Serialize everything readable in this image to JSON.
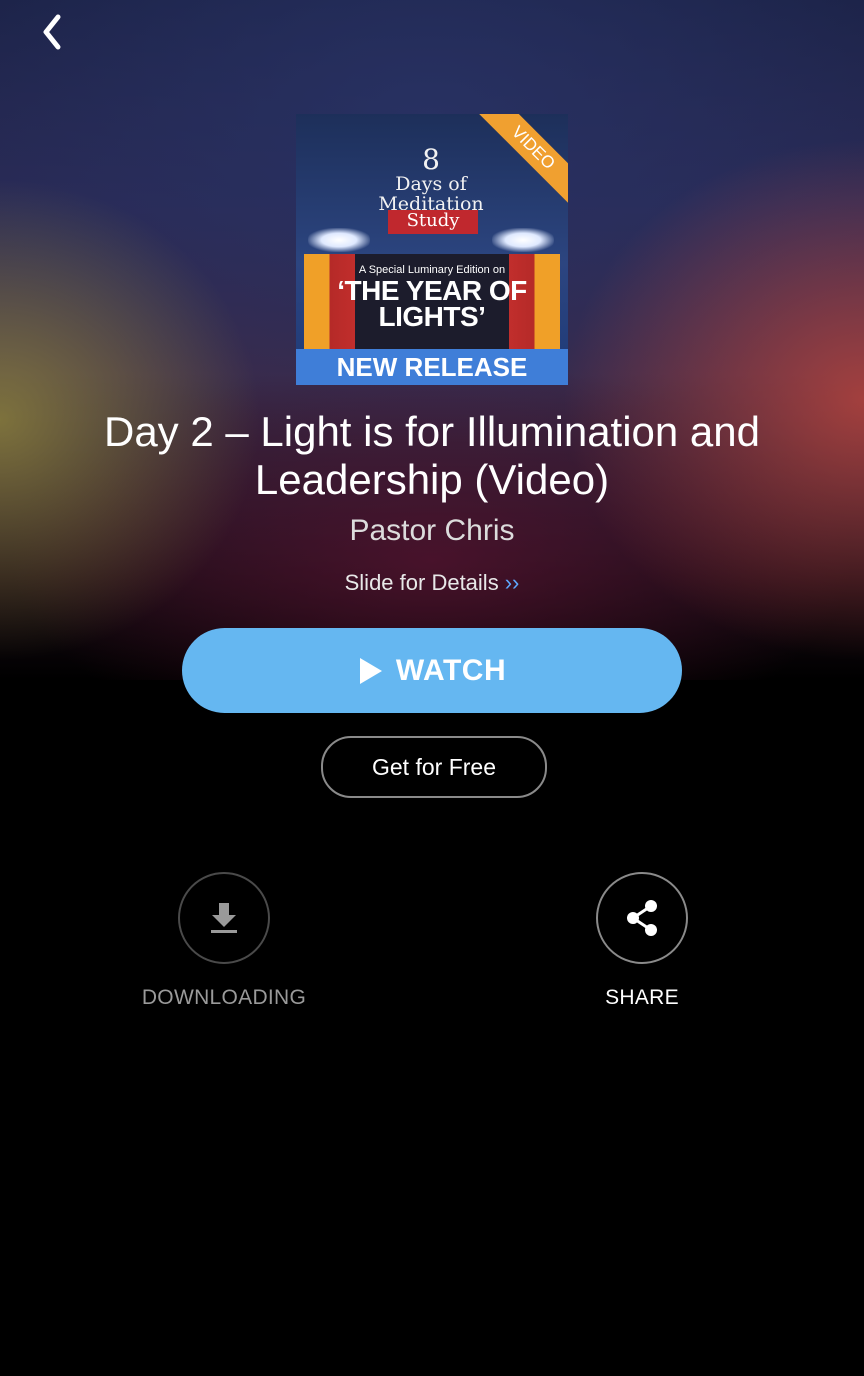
{
  "nav": {
    "back_icon": "chevron-left-icon"
  },
  "cover": {
    "title_number": "8",
    "title_line1": "Days of",
    "title_line2": "Meditation",
    "ribbon": "Study",
    "corner_tag": "VIDEO",
    "subtitle": "A Special Luminary Edition on",
    "headline": "‘THE YEAR OF LIGHTS’",
    "banner": "NEW RELEASE"
  },
  "content": {
    "title": "Day 2 – Light is for Illumination and Leadership (Video)",
    "author": "Pastor Chris",
    "details_label": "Slide for Details",
    "details_chevron": "››"
  },
  "actions": {
    "watch_label": "WATCH",
    "free_label": "Get for Free",
    "download_label": "DOWNLOADING",
    "share_label": "SHARE"
  },
  "colors": {
    "accent": "#65b7f1",
    "chevron": "#5ea8ff"
  }
}
